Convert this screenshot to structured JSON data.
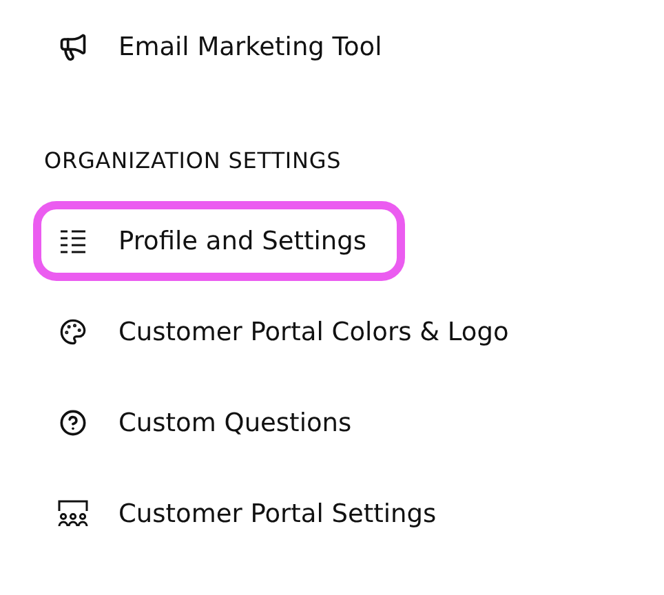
{
  "top_items": [
    {
      "label": "Email Marketing Tool",
      "selected": false
    }
  ],
  "section": {
    "heading": "ORGANIZATION SETTINGS",
    "items": [
      {
        "label": "Profile and Settings",
        "selected": true
      },
      {
        "label": "Customer Portal Colors & Logo",
        "selected": false
      },
      {
        "label": "Custom Questions",
        "selected": false
      },
      {
        "label": "Customer Portal Settings",
        "selected": false
      }
    ]
  }
}
